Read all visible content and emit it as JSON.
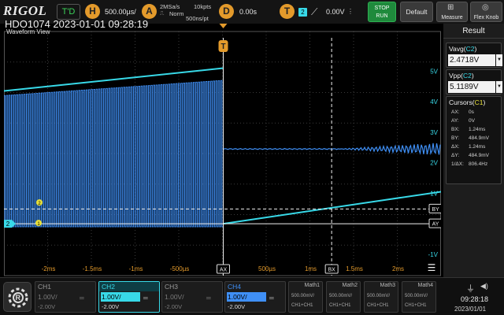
{
  "topbar": {
    "logo": "RIGOL",
    "trigger_status": "T'D",
    "horizontal": {
      "key": "H",
      "timebase": "500.00µs/",
      "sample_rate": "2MSa/s",
      "memory_depth": "10kpts",
      "mode": "Norm",
      "sample_interval": "500ns/pt"
    },
    "acquire": {
      "key": "A"
    },
    "delay": {
      "key": "D",
      "value": "0.00s"
    },
    "trigger": {
      "key": "T",
      "channel": "2",
      "slope_icon": "rising-edge",
      "level": "0.00V"
    },
    "buttons": {
      "stop_run": "STOP\nRUN",
      "default": "Default",
      "measure": "Measure",
      "flex_knob": "Flex Knob"
    }
  },
  "title": {
    "model_datetime": "HDO1074 2023-01-01 09:28:19",
    "view": "Waveform View"
  },
  "grid": {
    "ylabels": [
      "5V",
      "4V",
      "3V",
      "2V",
      "1V",
      "-1V"
    ],
    "xlabels": [
      "-2ms",
      "-1.5ms",
      "-1ms",
      "-500µs",
      "500µs",
      "1ms",
      "1.5ms",
      "2ms"
    ],
    "trigger_pos_label": "T",
    "cursor_labels": {
      "ax": "AX",
      "bx": "BX",
      "ay": "AY",
      "by": "BY"
    },
    "ch1_marker": "1",
    "ch2_marker": "2",
    "ch_marker_ref": "2"
  },
  "result": {
    "title": "Result",
    "measurements": [
      {
        "name": "Vavg",
        "channel": "C2",
        "value": "2.4718V"
      },
      {
        "name": "Vpp",
        "channel": "C2",
        "value": "5.1189V"
      }
    ],
    "cursors": {
      "title": "Cursors",
      "channel": "C1",
      "rows": [
        {
          "k": "AX:",
          "v": "0s"
        },
        {
          "k": "AY:",
          "v": "0V"
        },
        {
          "k": "BX:",
          "v": "1.24ms"
        },
        {
          "k": "BY:",
          "v": "484.9mV"
        },
        {
          "k": "ΔX:",
          "v": "1.24ms"
        },
        {
          "k": "ΔY:",
          "v": "484.9mV"
        },
        {
          "k": "1/ΔX:",
          "v": "806.4Hz"
        }
      ]
    }
  },
  "bottom": {
    "channels": [
      {
        "name": "CH1",
        "scale": "1.00V/",
        "offset": "-2.00V",
        "color": "#e8e03a",
        "active": false,
        "enabled": false
      },
      {
        "name": "CH2",
        "scale": "1.00V/",
        "offset": "-2.00V",
        "color": "#38d9e8",
        "active": true,
        "enabled": true
      },
      {
        "name": "CH3",
        "scale": "1.00V/",
        "offset": "-2.00V",
        "color": "#e04cd0",
        "active": false,
        "enabled": false
      },
      {
        "name": "CH4",
        "scale": "1.00V/",
        "offset": "-2.00V",
        "color": "#3f8ff5",
        "active": false,
        "enabled": true
      }
    ],
    "math": [
      {
        "name": "Math1",
        "line1": "500.00mV/",
        "line2": "CH1+CH1"
      },
      {
        "name": "Math2",
        "line1": "500.00mV/",
        "line2": "CH1+CH1"
      },
      {
        "name": "Math3",
        "line1": "500.00mV/",
        "line2": "CH1+CH1"
      },
      {
        "name": "Math4",
        "line1": "500.00mV/",
        "line2": "CH1+CH1"
      }
    ],
    "time": "09:28:18",
    "date": "2023/01/01"
  },
  "colors": {
    "ch1": "#e8e03a",
    "ch2": "#38d9e8",
    "ch4": "#3f8ff5",
    "accent": "#e39a2b",
    "run": "#1f8a3c"
  }
}
